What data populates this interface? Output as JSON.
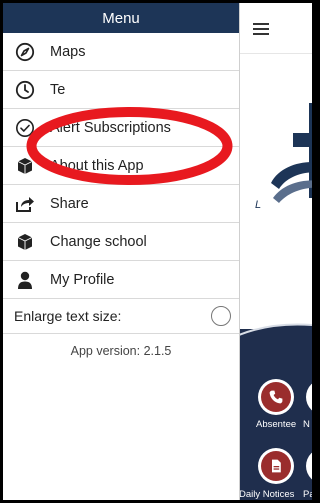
{
  "drawer": {
    "title": "Menu",
    "items": [
      {
        "label": "Maps",
        "icon": "compass-icon"
      },
      {
        "label": "Te",
        "icon": "clock-icon"
      },
      {
        "label": "Alert Subscriptions",
        "icon": "check-circle-icon"
      },
      {
        "label": "About this App",
        "icon": "cube-icon"
      },
      {
        "label": "Share",
        "icon": "share-icon"
      },
      {
        "label": "Change school",
        "icon": "cube-icon"
      },
      {
        "label": "My Profile",
        "icon": "person-icon"
      }
    ],
    "enlarge_label": "Enlarge text size:",
    "version": "App version: 2.1.5"
  },
  "app": {
    "logo_letter": "L",
    "buttons": [
      {
        "label": "Absentee",
        "icon": "phone-icon"
      },
      {
        "label": "N",
        "icon": "unknown-icon"
      },
      {
        "label": "Daily Notices",
        "icon": "document-icon"
      },
      {
        "label": "Pa",
        "icon": "unknown-icon"
      }
    ]
  },
  "colors": {
    "drawer_header": "#1d3557",
    "annotation": "#e8191f",
    "app_bottom": "#1f2e4d",
    "button_fill": "#9a2d2d"
  }
}
